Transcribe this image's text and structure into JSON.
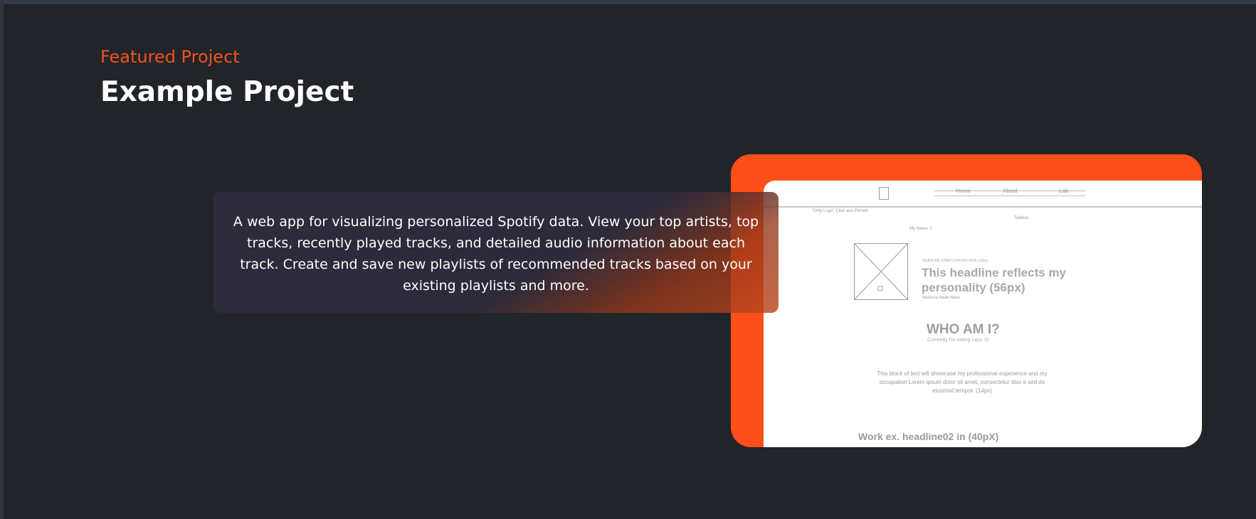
{
  "section": {
    "eyebrow": "Featured Project",
    "title": "Example Project"
  },
  "project": {
    "description": "A web app for visualizing personalized Spotify data. View your top artists, top tracks, recently played tracks, and detailed audio information about each track. Create and save new playlists of recommended tracks based on your existing playlists and more.",
    "accent_color": "#fc4f1a"
  },
  "preview": {
    "nav": [
      "Home",
      "About",
      "Lab"
    ],
    "logo_note": "\"Only Logo\" Click and Pinned",
    "tabs_note": "Tabless",
    "my_name_note": "My Name :)",
    "image_caption": "",
    "headline_small": "HEADLINE STARTS FROM HERE (18px)",
    "headline": "This headline reflects my personality (56px)",
    "headline_sub": "Hosted by Studio Name",
    "who_title": "WHO AM I?",
    "who_sub": "Currently I'm eating Lays :D",
    "block_text": "This block of text will showcase my professional experience and my occupation Lorem ipsum dolor sit amet, consectetur disc e sed do eiusmod tempor. (14px)",
    "work_headline": "Work ex. headline02 in (40pX)"
  }
}
